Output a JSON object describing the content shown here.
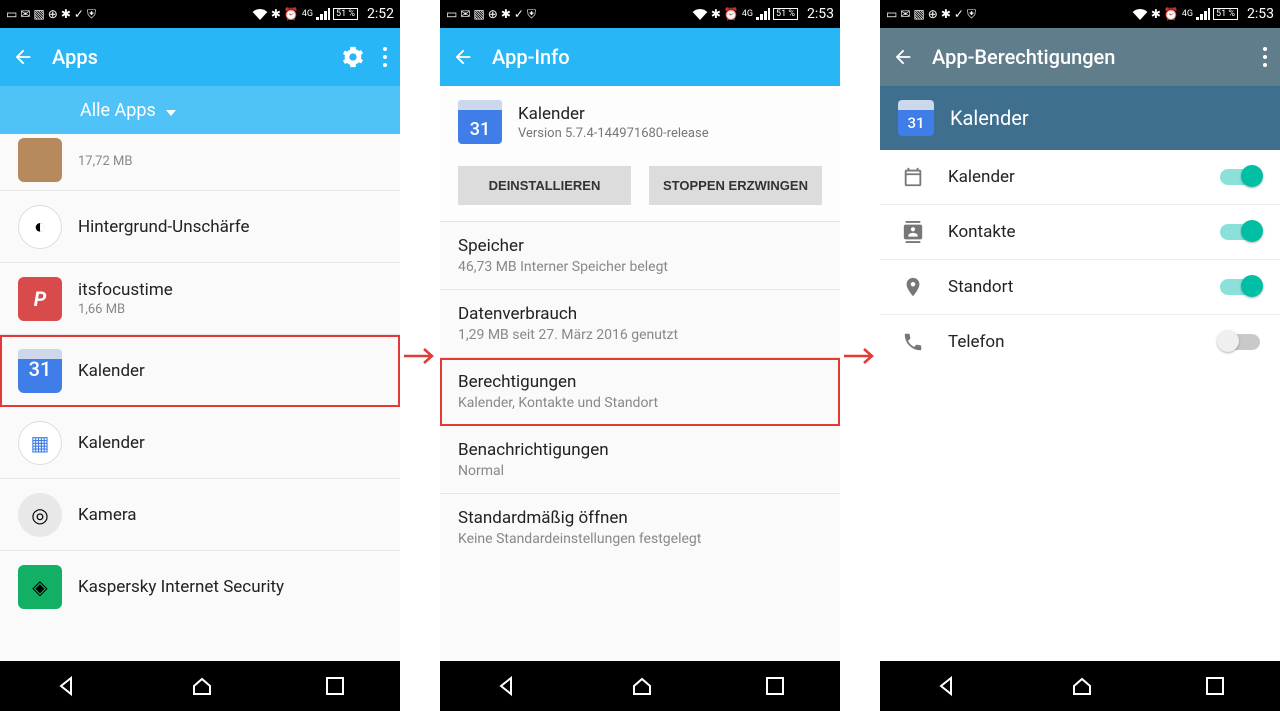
{
  "status": {
    "battery": "51 %",
    "time1": "2:52",
    "time2": "2:53",
    "net": "4G"
  },
  "screen1": {
    "title": "Apps",
    "dropdown": "Alle Apps",
    "items": [
      {
        "name": "",
        "sub": "17,72 MB",
        "icon": "hearth"
      },
      {
        "name": "Hintergrund-Unschärfe",
        "sub": "",
        "icon": "blur"
      },
      {
        "name": "itsfocustime",
        "sub": "1,66 MB",
        "icon": "p"
      },
      {
        "name": "Kalender",
        "sub": "",
        "icon": "cal",
        "highlight": true
      },
      {
        "name": "Kalender",
        "sub": "",
        "icon": "cal2"
      },
      {
        "name": "Kamera",
        "sub": "",
        "icon": "cam"
      },
      {
        "name": "Kaspersky Internet Security",
        "sub": "",
        "icon": "kis"
      }
    ]
  },
  "screen2": {
    "title": "App-Info",
    "app": {
      "name": "Kalender",
      "version": "Version 5.7.4-144971680-release",
      "iconDay": "31"
    },
    "buttons": {
      "uninstall": "DEINSTALLIEREN",
      "forceStop": "STOPPEN ERZWINGEN"
    },
    "rows": [
      {
        "t": "Speicher",
        "s": "46,73 MB Interner Speicher belegt"
      },
      {
        "t": "Datenverbrauch",
        "s": "1,29 MB seit 27. März 2016 genutzt"
      },
      {
        "t": "Berechtigungen",
        "s": "Kalender, Kontakte und Standort",
        "highlight": true
      },
      {
        "t": "Benachrichtigungen",
        "s": "Normal"
      },
      {
        "t": "Standardmäßig öffnen",
        "s": "Keine Standardeinstellungen festgelegt"
      }
    ]
  },
  "screen3": {
    "title": "App-Berechtigungen",
    "app": {
      "name": "Kalender",
      "iconDay": "31"
    },
    "perms": [
      {
        "label": "Kalender",
        "icon": "calendar",
        "on": true
      },
      {
        "label": "Kontakte",
        "icon": "contacts",
        "on": true
      },
      {
        "label": "Standort",
        "icon": "location",
        "on": true
      },
      {
        "label": "Telefon",
        "icon": "phone",
        "on": false
      }
    ]
  }
}
